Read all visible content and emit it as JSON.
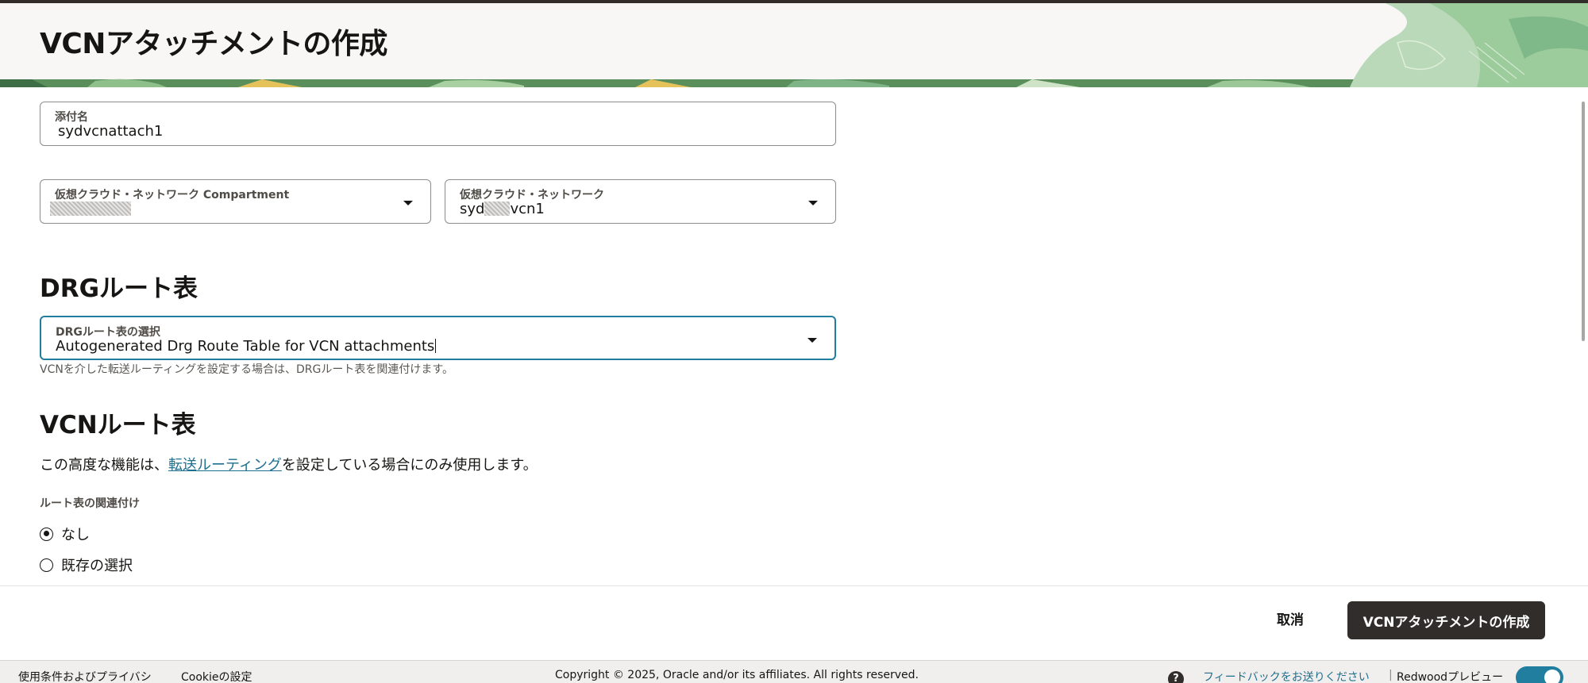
{
  "page": {
    "title": "VCNアタッチメントの作成"
  },
  "form": {
    "attachment_name": {
      "label": "添付名",
      "value": "sydvcnattach1"
    },
    "vcn_compartment": {
      "label": "仮想クラウド・ネットワーク Compartment",
      "value": ""
    },
    "vcn": {
      "label": "仮想クラウド・ネットワーク",
      "value_prefix": "syd",
      "value_suffix": "vcn1"
    }
  },
  "drg": {
    "section_title": "DRGルート表",
    "select_label": "DRGルート表の選択",
    "select_value": "Autogenerated Drg Route Table for VCN attachments",
    "help_text": "VCNを介した転送ルーティングを設定する場合は、DRGルート表を関連付けます。"
  },
  "vcn_route": {
    "section_title": "VCNルート表",
    "desc_before": "この高度な機能は、",
    "desc_link": "転送ルーティング",
    "desc_after": "を設定している場合にのみ使用します。",
    "group_label": "ルート表の関連付け",
    "options": [
      {
        "label": "なし",
        "checked": true
      },
      {
        "label": "既存の選択",
        "checked": false
      }
    ]
  },
  "actions": {
    "cancel": "取消",
    "create": "VCNアタッチメントの作成"
  },
  "footer": {
    "terms": "使用条件およびプライバシ",
    "cookie": "Cookieの設定",
    "copyright": "Copyright © 2025, Oracle and/or its affiliates. All rights reserved.",
    "help_icon": "?",
    "feedback": "フィードバックをお送りください",
    "separator": "|",
    "redwood_preview": "Redwoodプレビュー",
    "redwood_toggle_on": true
  },
  "colors": {
    "accent": "#227e9e",
    "link": "#1e6f8e",
    "primary_button": "#312d2a",
    "header_bg": "#f8f7f5"
  }
}
